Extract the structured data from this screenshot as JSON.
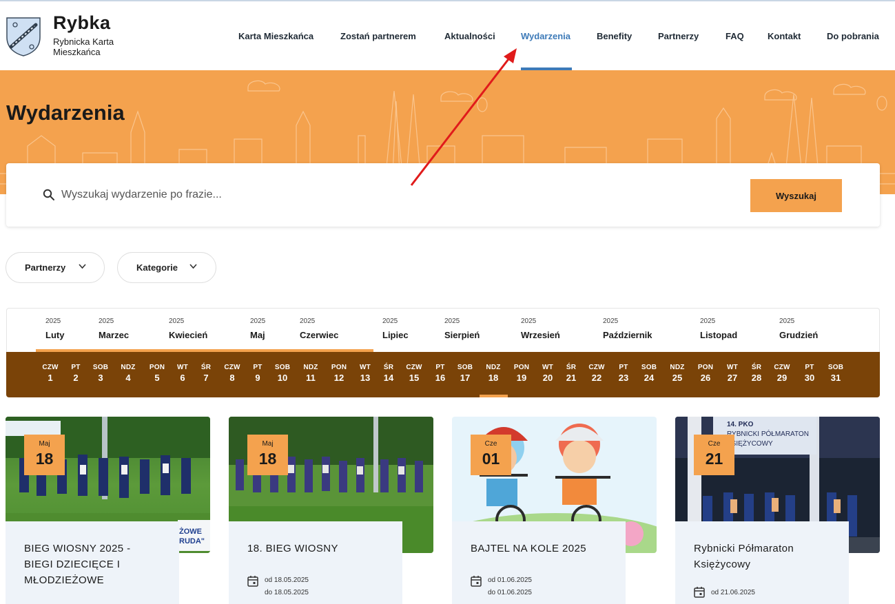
{
  "header": {
    "logo_title": "Rybka",
    "logo_subtitle": "Rybnicka Karta Mieszkańca",
    "nav": [
      {
        "label": "Karta Mieszkańca",
        "active": false
      },
      {
        "label": "Zostań partnerem",
        "active": false
      },
      {
        "label": "Aktualności",
        "active": false
      },
      {
        "label": "Wydarzenia",
        "active": true
      },
      {
        "label": "Benefity",
        "active": false
      },
      {
        "label": "Partnerzy",
        "active": false
      },
      {
        "label": "FAQ",
        "active": false
      },
      {
        "label": "Kontakt",
        "active": false
      },
      {
        "label": "Do pobrania",
        "active": false
      }
    ]
  },
  "hero": {
    "title": "Wydarzenia"
  },
  "search": {
    "placeholder": "Wyszukaj wydarzenie po frazie...",
    "button_label": "Wyszukaj"
  },
  "filters": [
    {
      "label": "Partnerzy"
    },
    {
      "label": "Kategorie"
    }
  ],
  "months": [
    {
      "year": "2025",
      "name": "Luty"
    },
    {
      "year": "2025",
      "name": "Marzec"
    },
    {
      "year": "2025",
      "name": "Kwiecień"
    },
    {
      "year": "2025",
      "name": "Maj"
    },
    {
      "year": "2025",
      "name": "Czerwiec"
    },
    {
      "year": "2025",
      "name": "Lipiec"
    },
    {
      "year": "2025",
      "name": "Sierpień"
    },
    {
      "year": "2025",
      "name": "Wrzesień"
    },
    {
      "year": "2025",
      "name": "Październik"
    },
    {
      "year": "2025",
      "name": "Listopad"
    },
    {
      "year": "2025",
      "name": "Grudzień"
    }
  ],
  "days": [
    {
      "dn": "CZW",
      "dd": "1"
    },
    {
      "dn": "PT",
      "dd": "2"
    },
    {
      "dn": "SOB",
      "dd": "3"
    },
    {
      "dn": "NDZ",
      "dd": "4"
    },
    {
      "dn": "PON",
      "dd": "5"
    },
    {
      "dn": "WT",
      "dd": "6"
    },
    {
      "dn": "ŚR",
      "dd": "7"
    },
    {
      "dn": "CZW",
      "dd": "8"
    },
    {
      "dn": "PT",
      "dd": "9"
    },
    {
      "dn": "SOB",
      "dd": "10"
    },
    {
      "dn": "NDZ",
      "dd": "11"
    },
    {
      "dn": "PON",
      "dd": "12"
    },
    {
      "dn": "WT",
      "dd": "13"
    },
    {
      "dn": "ŚR",
      "dd": "14"
    },
    {
      "dn": "CZW",
      "dd": "15"
    },
    {
      "dn": "PT",
      "dd": "16"
    },
    {
      "dn": "SOB",
      "dd": "17"
    },
    {
      "dn": "NDZ",
      "dd": "18"
    },
    {
      "dn": "PON",
      "dd": "19"
    },
    {
      "dn": "WT",
      "dd": "20"
    },
    {
      "dn": "ŚR",
      "dd": "21"
    },
    {
      "dn": "CZW",
      "dd": "22"
    },
    {
      "dn": "PT",
      "dd": "23"
    },
    {
      "dn": "SOB",
      "dd": "24"
    },
    {
      "dn": "NDZ",
      "dd": "25"
    },
    {
      "dn": "PON",
      "dd": "26"
    },
    {
      "dn": "WT",
      "dd": "27"
    },
    {
      "dn": "ŚR",
      "dd": "28"
    },
    {
      "dn": "CZW",
      "dd": "29"
    },
    {
      "dn": "PT",
      "dd": "30"
    },
    {
      "dn": "SOB",
      "dd": "31"
    }
  ],
  "events": [
    {
      "month": "Maj",
      "day": "18",
      "title": "BIEG WIOSNY 2025 - BIEGI DZIECIĘCE I MŁODZIEŻOWE",
      "date_from": "",
      "date_to": "",
      "banner_text": "ŻOWE\nRUDA\""
    },
    {
      "month": "Maj",
      "day": "18",
      "title": "18. BIEG WIOSNY",
      "date_from": "od 18.05.2025",
      "date_to": "do 18.05.2025"
    },
    {
      "month": "Cze",
      "day": "01",
      "title": "BAJTEL NA KOLE 2025",
      "date_from": "od 01.06.2025",
      "date_to": "do 01.06.2025"
    },
    {
      "month": "Cze",
      "day": "21",
      "title": "Rybnicki Półmaraton Księżycowy",
      "date_from": "od 21.06.2025",
      "date_to": "",
      "banner_text": "14. PKO\nRYBNICKI PÓŁMARATON\nKSIĘŻYCOWY"
    }
  ],
  "colors": {
    "accent_orange": "#f4a24e",
    "calendar_brown": "#7a4308",
    "active_blue": "#3d7ab8",
    "card_body": "#eef3f9"
  }
}
